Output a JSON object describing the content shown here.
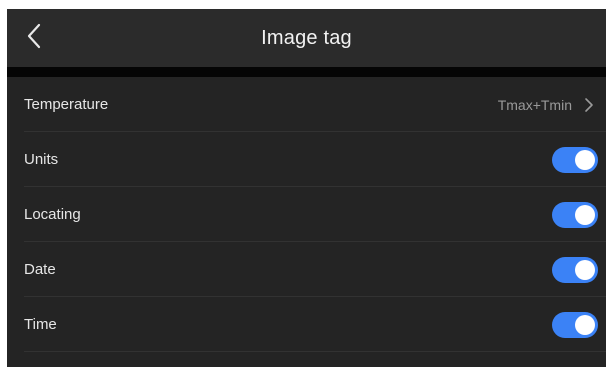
{
  "header": {
    "title": "Image tag",
    "back_icon": "chevron-left-icon"
  },
  "settings": {
    "temperature": {
      "label": "Temperature",
      "value": "Tmax+Tmin",
      "icon": "chevron-right-icon"
    },
    "units": {
      "label": "Units",
      "enabled": true
    },
    "locating": {
      "label": "Locating",
      "enabled": true
    },
    "date": {
      "label": "Date",
      "enabled": true
    },
    "time": {
      "label": "Time",
      "enabled": true
    }
  },
  "colors": {
    "toggle_on": "#3b82f6",
    "background": "#242424",
    "header": "#2b2b2b"
  }
}
